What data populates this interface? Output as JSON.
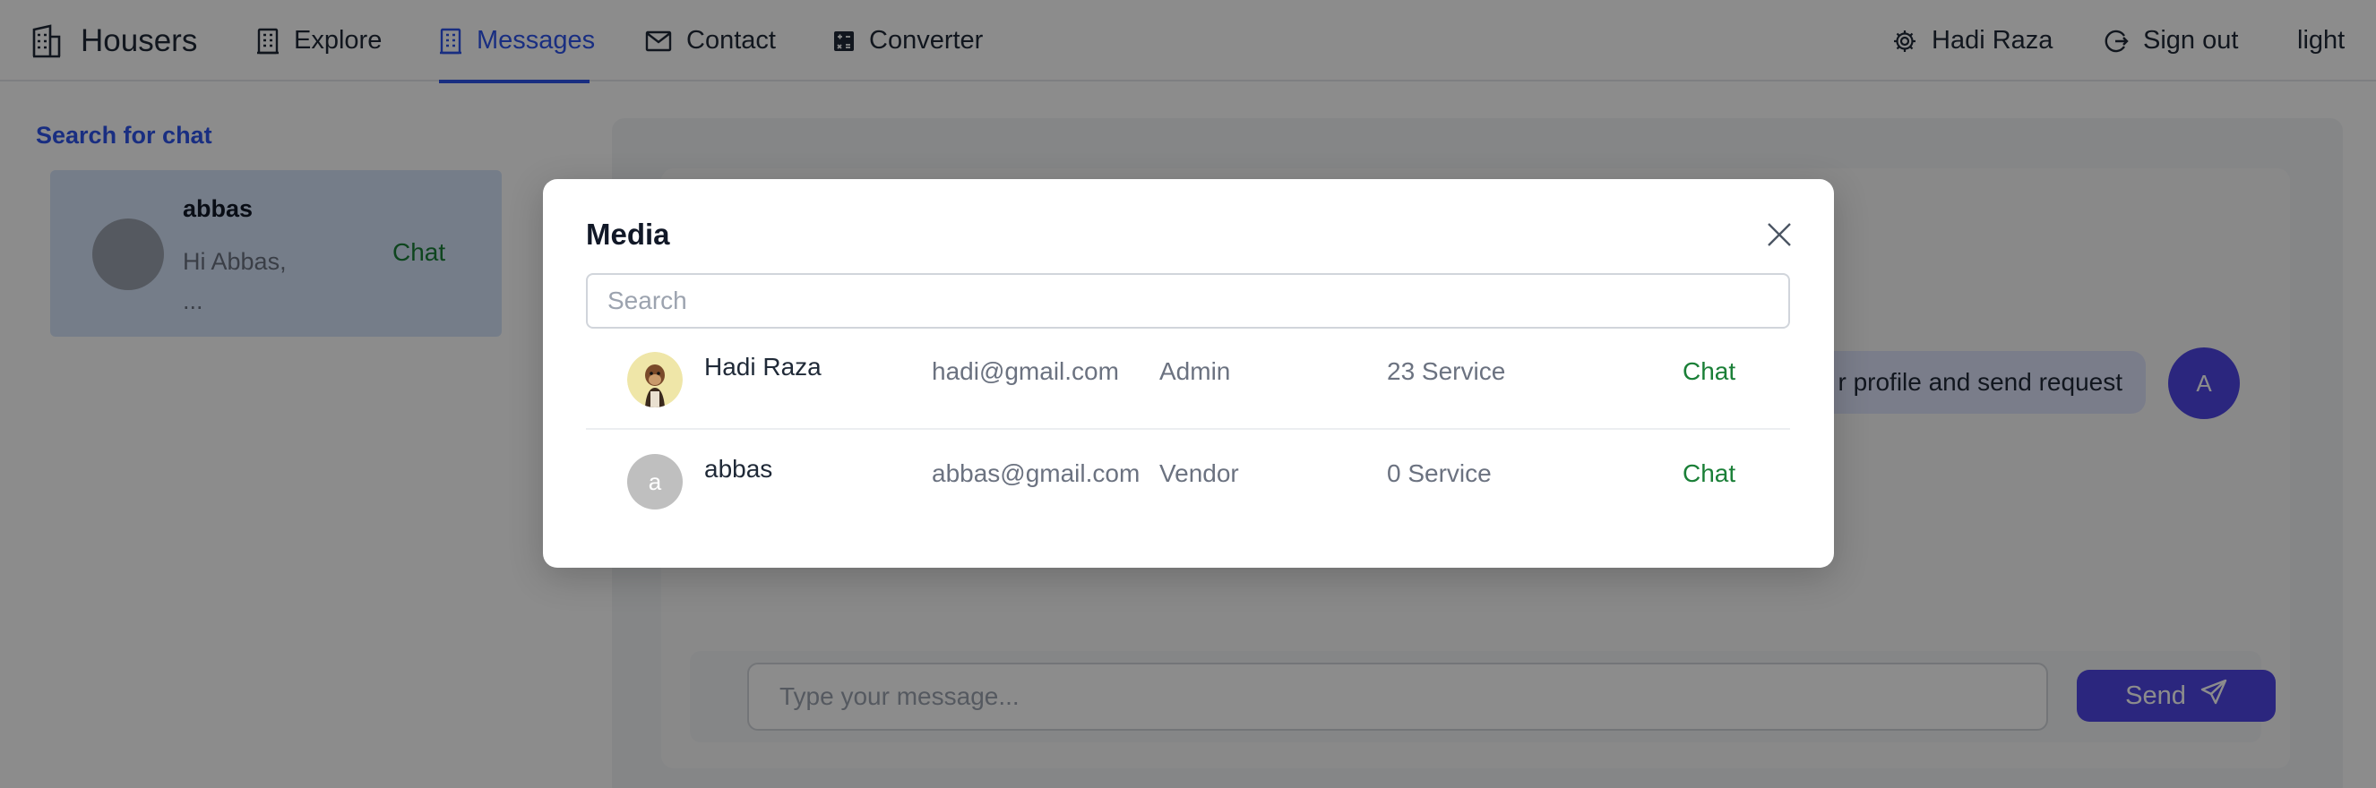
{
  "nav": {
    "brand": "Housers",
    "items": [
      {
        "label": "Explore",
        "icon": "building-icon"
      },
      {
        "label": "Messages",
        "icon": "message-icon",
        "active": true
      },
      {
        "label": "Contact",
        "icon": "mail-icon"
      },
      {
        "label": "Converter",
        "icon": "calculator-icon"
      }
    ],
    "user_name": "Hadi Raza",
    "sign_out": "Sign out",
    "theme_toggle": "light"
  },
  "sidebar": {
    "search_label": "Search for chat",
    "chats": [
      {
        "name": "abbas",
        "preview": "Hi Abbas, ...",
        "action": "Chat"
      }
    ]
  },
  "conversation": {
    "message_text": "r profile and send request",
    "avatar_initial": "A",
    "input_placeholder": "Type your message...",
    "send_label": "Send"
  },
  "modal": {
    "title": "Media",
    "search_placeholder": "Search",
    "users": [
      {
        "name": "Hadi Raza",
        "email": "hadi@gmail.com",
        "role": "Admin",
        "services": "23 Service",
        "action": "Chat",
        "avatar": "ape-avatar-image"
      },
      {
        "name": "abbas",
        "email": "abbas@gmail.com",
        "role": "Vendor",
        "services": "0 Service",
        "action": "Chat",
        "avatar_initial": "a"
      }
    ]
  },
  "colors": {
    "accent": "#2f54eb",
    "chat_green": "#1a7f37",
    "send_button": "#4f46e5",
    "overlay": "rgba(0,0,0,0.45)"
  }
}
